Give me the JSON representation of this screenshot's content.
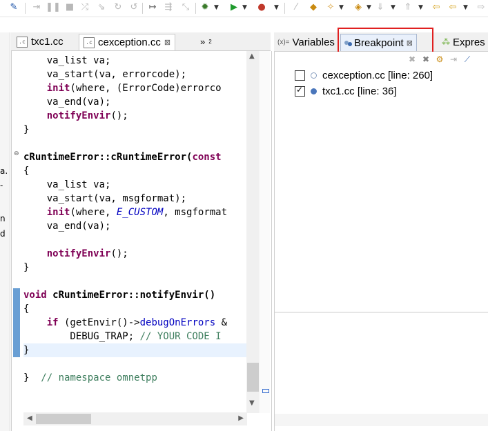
{
  "toolbar": {
    "icons": [
      "debug-icon",
      "step-into-icon",
      "resume-icon",
      "suspend-icon",
      "terminate-icon",
      "disconnect-icon",
      "step-over-icon",
      "step-return-icon",
      "drop-frame-icon",
      "use-step-filters-icon",
      "bug-icon",
      "run-icon",
      "external-tools-icon",
      "pen-icon",
      "open-type-icon",
      "search-icon",
      "task-icon",
      "next-annotation-icon",
      "prev-annotation-icon",
      "back-icon",
      "forward-icon"
    ]
  },
  "left_fragments": [
    "a.",
    "-",
    "n",
    "d"
  ],
  "editor": {
    "tabs": [
      {
        "label": "txc1.cc"
      },
      {
        "label": "cexception.cc",
        "close": "⊠"
      },
      {
        "label": "»",
        "count": "2"
      }
    ],
    "code": [
      "    va_list va;",
      "    va_start(va, errorcode);",
      "    init(where, (ErrorCode)errorco",
      "    va_end(va);",
      "    notifyEnvir();",
      "}",
      "",
      "cRuntimeError::cRuntimeError(const",
      "{",
      "    va_list va;",
      "    va_start(va, msgformat);",
      "    init(where, E_CUSTOM, msgformat",
      "    va_end(va);",
      "",
      "    notifyEnvir();",
      "}",
      "",
      "void cRuntimeError::notifyEnvir()",
      "{",
      "    if (getEnvir()->debugOnErrors &",
      "        DEBUG_TRAP; // YOUR CODE I",
      "}",
      "",
      "}  // namespace omnetpp"
    ]
  },
  "view": {
    "tabs": [
      {
        "label": "Variables",
        "icon": "(x)="
      },
      {
        "label": "Breakpoint",
        "close": "⊠"
      },
      {
        "label": "Expres"
      }
    ],
    "breakpoints": [
      {
        "label": "cexception.cc [line: 260]",
        "checked": false
      },
      {
        "label": "txc1.cc [line: 36]",
        "checked": true
      }
    ]
  },
  "colors": {
    "keyword": "#7f0055",
    "comment": "#3f7f5f",
    "enum": "#0000c0",
    "highlight_box": "#e02020",
    "current_line": "#e8f2fe"
  }
}
